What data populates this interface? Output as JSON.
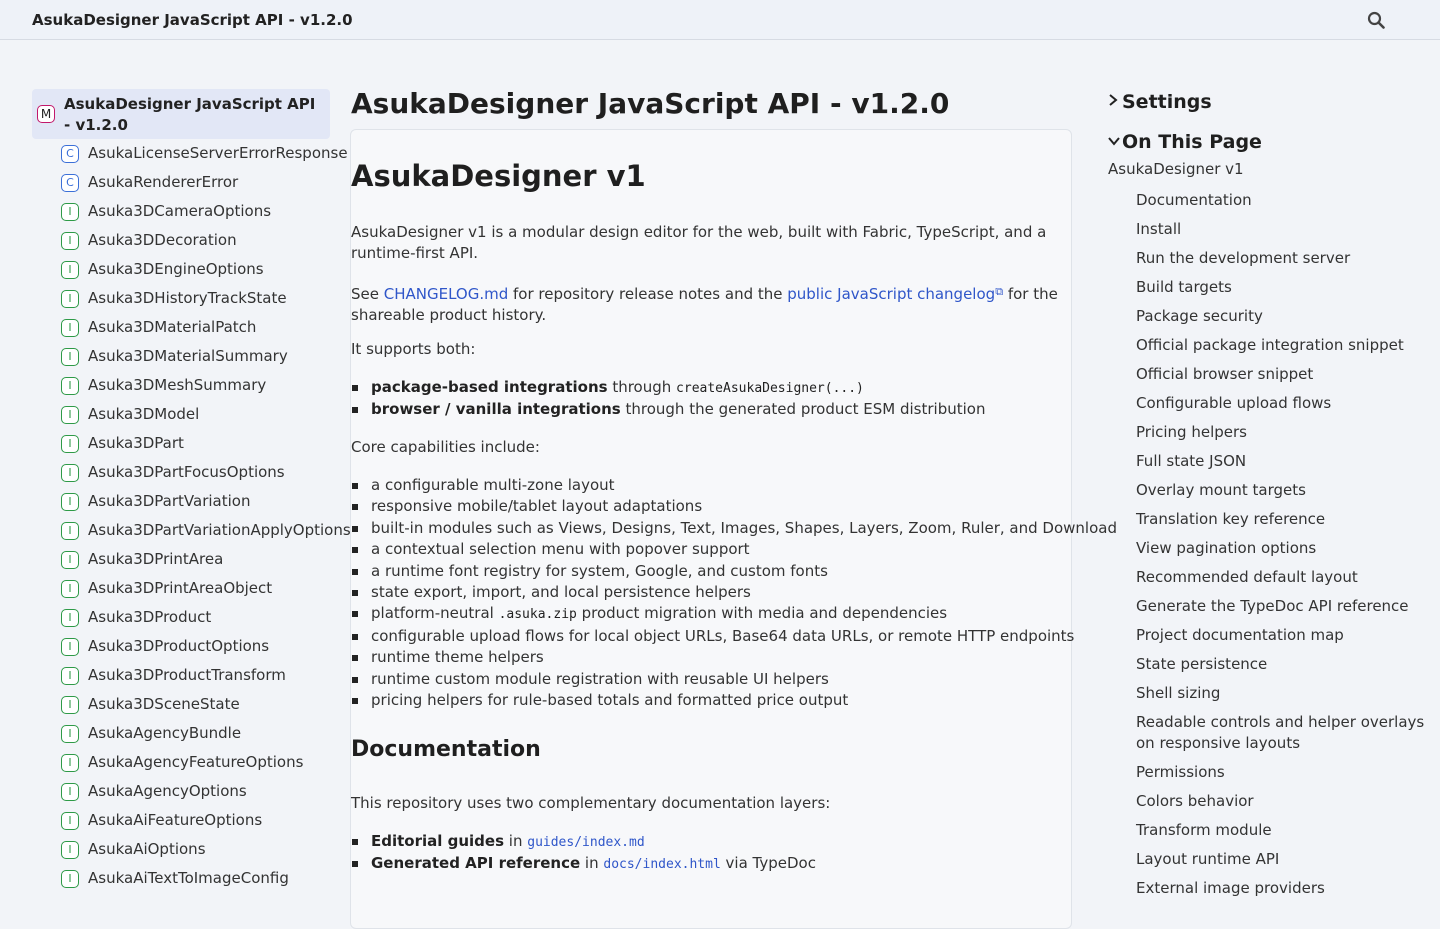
{
  "header": {
    "title": "AsukaDesigner JavaScript API - v1.2.0",
    "search_icon": "search-icon"
  },
  "sidebar": {
    "module": {
      "badge": "M",
      "label": "AsukaDesigner JavaScript API - v1.2.0"
    },
    "items": [
      {
        "kind": "class",
        "badge": "C",
        "label": "AsukaLicenseServerErrorResponse"
      },
      {
        "kind": "class",
        "badge": "C",
        "label": "AsukaRendererError"
      },
      {
        "kind": "iface",
        "badge": "I",
        "label": "Asuka3DCameraOptions"
      },
      {
        "kind": "iface",
        "badge": "I",
        "label": "Asuka3DDecoration"
      },
      {
        "kind": "iface",
        "badge": "I",
        "label": "Asuka3DEngineOptions"
      },
      {
        "kind": "iface",
        "badge": "I",
        "label": "Asuka3DHistoryTrackState"
      },
      {
        "kind": "iface",
        "badge": "I",
        "label": "Asuka3DMaterialPatch"
      },
      {
        "kind": "iface",
        "badge": "I",
        "label": "Asuka3DMaterialSummary"
      },
      {
        "kind": "iface",
        "badge": "I",
        "label": "Asuka3DMeshSummary"
      },
      {
        "kind": "iface",
        "badge": "I",
        "label": "Asuka3DModel"
      },
      {
        "kind": "iface",
        "badge": "I",
        "label": "Asuka3DPart"
      },
      {
        "kind": "iface",
        "badge": "I",
        "label": "Asuka3DPartFocusOptions"
      },
      {
        "kind": "iface",
        "badge": "I",
        "label": "Asuka3DPartVariation"
      },
      {
        "kind": "iface",
        "badge": "I",
        "label": "Asuka3DPartVariationApplyOptions"
      },
      {
        "kind": "iface",
        "badge": "I",
        "label": "Asuka3DPrintArea"
      },
      {
        "kind": "iface",
        "badge": "I",
        "label": "Asuka3DPrintAreaObject"
      },
      {
        "kind": "iface",
        "badge": "I",
        "label": "Asuka3DProduct"
      },
      {
        "kind": "iface",
        "badge": "I",
        "label": "Asuka3DProductOptions"
      },
      {
        "kind": "iface",
        "badge": "I",
        "label": "Asuka3DProductTransform"
      },
      {
        "kind": "iface",
        "badge": "I",
        "label": "Asuka3DSceneState"
      },
      {
        "kind": "iface",
        "badge": "I",
        "label": "AsukaAgencyBundle"
      },
      {
        "kind": "iface",
        "badge": "I",
        "label": "AsukaAgencyFeatureOptions"
      },
      {
        "kind": "iface",
        "badge": "I",
        "label": "AsukaAgencyOptions"
      },
      {
        "kind": "iface",
        "badge": "I",
        "label": "AsukaAiFeatureOptions"
      },
      {
        "kind": "iface",
        "badge": "I",
        "label": "AsukaAiOptions"
      },
      {
        "kind": "iface",
        "badge": "I",
        "label": "AsukaAiTextToImageConfig"
      }
    ]
  },
  "main": {
    "page_title": "AsukaDesigner JavaScript API - v1.2.0",
    "h1": "AsukaDesigner v1",
    "intro": "AsukaDesigner v1 is a modular design editor for the web, built with Fabric, TypeScript, and a runtime-first API.",
    "see": {
      "prefix": "See ",
      "link1": "CHANGELOG.md",
      "middle": " for repository release notes and the ",
      "link2": "public JavaScript changelog",
      "suffix": " for the shareable product history."
    },
    "supports_intro": "It supports both:",
    "supports": [
      {
        "bold": "package-based integrations",
        "text": " through ",
        "code": "createAsukaDesigner(...)"
      },
      {
        "bold": "browser / vanilla integrations",
        "text": " through the generated product ESM distribution"
      }
    ],
    "capabilities_intro": "Core capabilities include:",
    "capabilities": {
      "c1": "a configurable multi-zone layout",
      "c2": "responsive mobile/tablet layout adaptations",
      "c3": "built-in modules such as Views, Designs, Text, Images, Shapes, Layers, Zoom, Ruler, and Download",
      "c4": "a contextual selection menu with popover support",
      "c5": "a runtime font registry for system, Google, and custom fonts",
      "c6": "state export, import, and local persistence helpers",
      "c7_pre": "platform-neutral ",
      "c7_code": ".asuka.zip",
      "c7_post": " product migration with media and dependencies",
      "c8": "configurable upload flows for local object URLs, Base64 data URLs, or remote HTTP endpoints",
      "c9": "runtime theme helpers",
      "c10": "runtime custom module registration with reusable UI helpers",
      "c11": "pricing helpers for rule-based totals and formatted price output"
    },
    "documentation": {
      "heading": "Documentation",
      "intro": "This repository uses two complementary documentation layers:",
      "item1_bold": "Editorial guides",
      "item1_in": " in ",
      "item1_code": "guides/index.md",
      "item2_bold": "Generated API reference",
      "item2_in": " in ",
      "item2_code": "docs/index.html",
      "item2_via": " via TypeDoc"
    }
  },
  "right": {
    "settings": "Settings",
    "on_this_page": "On This Page",
    "toc_top": "AsukaDesigner v1",
    "toc": [
      "Documentation",
      "Install",
      "Run the development server",
      "Build targets",
      "Package security",
      "Official package integration snippet",
      "Official browser snippet",
      "Configurable upload flows",
      "Pricing helpers",
      "Full state JSON",
      "Overlay mount targets",
      "Translation key reference",
      "View pagination options",
      "Recommended default layout",
      "Generate the TypeDoc API reference",
      "Project documentation map",
      "State persistence",
      "Shell sizing",
      "Readable controls and helper overlays on responsive layouts",
      "Permissions",
      "Colors behavior",
      "Transform module",
      "Layout runtime API",
      "External image providers"
    ]
  }
}
